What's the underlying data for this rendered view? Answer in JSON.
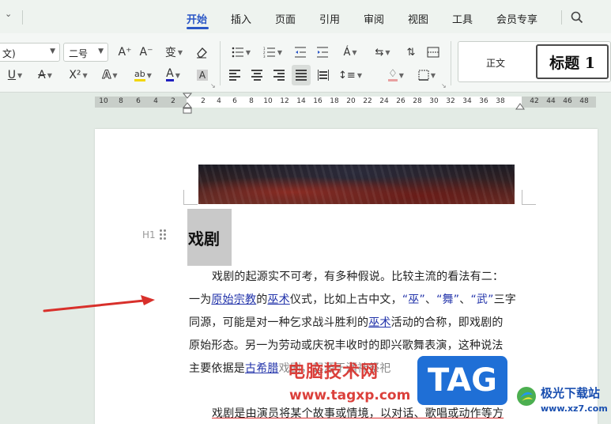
{
  "menubar": {
    "tabs": [
      "开始",
      "插入",
      "页面",
      "引用",
      "审阅",
      "视图",
      "工具",
      "会员专享"
    ],
    "active_tab": "开始"
  },
  "toolbar": {
    "font_name": "文)",
    "font_size": "二号",
    "grow_font": "A⁺",
    "shrink_font": "A⁻",
    "phonetic": "变",
    "underline": "U",
    "strikethrough": "A",
    "superscript": "X²",
    "text_effect": "A",
    "highlight": "ab",
    "font_color": "A",
    "char_shading": "A"
  },
  "styles": {
    "normal": "正文",
    "heading1": "标题 1"
  },
  "ruler": {
    "left_numbers": [
      "10",
      "8",
      "6",
      "4",
      "2"
    ],
    "right_numbers": [
      "2",
      "4",
      "6",
      "8",
      "10",
      "12",
      "14",
      "16",
      "18",
      "20",
      "22",
      "24",
      "26",
      "28",
      "30",
      "32",
      "34",
      "36",
      "38"
    ],
    "far_right_numbers": [
      "42",
      "44",
      "46",
      "48"
    ]
  },
  "document": {
    "heading_marker": "H1",
    "heading": "戏剧",
    "para1": {
      "line1": "戏剧的起源实不可考，有多种假说。比较主流的看法有二：",
      "line2_a": "一为",
      "line2_link1": "原始宗教",
      "line2_b": "的",
      "line2_link2": "巫术",
      "line2_c": "仪式，比如上古中文，",
      "line2_q1": "“巫”",
      "line2_d": "、",
      "line2_q2": "“舞”",
      "line2_e": "、",
      "line2_q3": "“武”",
      "line2_f": "三字",
      "line3_a": "同源，可能是对一种乞求战斗胜利的",
      "line3_link": "巫术",
      "line3_b": "活动的合称，即戏剧的",
      "line4": "原始形态。另一为劳动或庆祝丰收时的即兴歌舞表演，这种说法",
      "line5_a": "主要依据是",
      "line5_link": "古希腊",
      "line5_b": "戏剧，起源于酒神祭祀"
    },
    "para2": "戏剧是由演员将某个故事或情境，以对话、歌唱或动作等方"
  },
  "watermark": {
    "site_name": "电脑技术网",
    "site_url": "www.tagxp.com",
    "tag": "TAG",
    "logo_text": "极光下载站",
    "logo_url": "www.xz7.com"
  },
  "colors": {
    "accent": "#2a56c6",
    "arrow": "#d8302b",
    "link": "#2233aa"
  }
}
